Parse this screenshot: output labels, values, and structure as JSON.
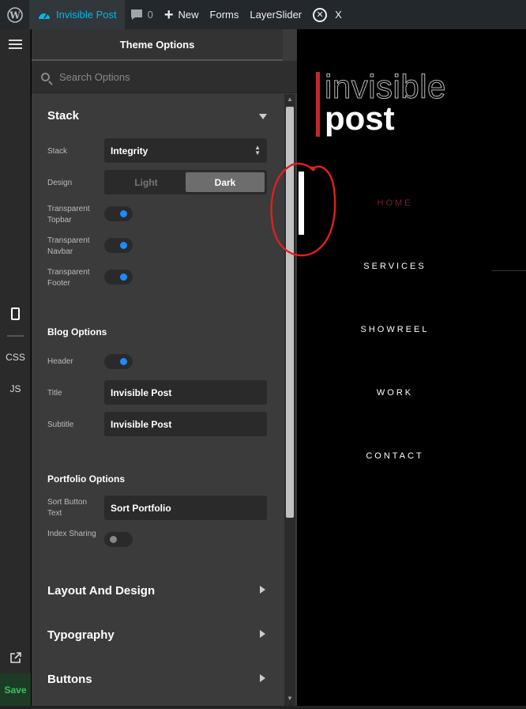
{
  "adminbar": {
    "site_name": "Invisible Post",
    "comments_count": "0",
    "new_label": "New",
    "forms_label": "Forms",
    "layerslider_label": "LayerSlider",
    "x_label": "X"
  },
  "rail": {
    "css_label": "CSS",
    "js_label": "JS",
    "save_label": "Save"
  },
  "panel": {
    "title": "Theme Options",
    "search_placeholder": "Search Options",
    "stack_section": {
      "title": "Stack",
      "stack_label": "Stack",
      "stack_value": "Integrity",
      "design_label": "Design",
      "design_options": [
        "Light",
        "Dark"
      ],
      "design_selected": "Dark",
      "transparent_topbar_label": "Transparent Topbar",
      "transparent_topbar_on": true,
      "transparent_navbar_label": "Transparent Navbar",
      "transparent_navbar_on": true,
      "transparent_footer_label": "Transparent Footer",
      "transparent_footer_on": true
    },
    "blog_options": {
      "title": "Blog Options",
      "header_label": "Header",
      "header_on": true,
      "title_label": "Title",
      "title_value": "Invisible Post",
      "subtitle_label": "Subtitle",
      "subtitle_value": "Invisible Post"
    },
    "portfolio_options": {
      "title": "Portfolio Options",
      "sort_button_label": "Sort Button Text",
      "sort_button_value": "Sort Portfolio",
      "index_sharing_label": "Index Sharing",
      "index_sharing_on": false
    },
    "collapsed_sections": {
      "layout": "Layout And Design",
      "typography": "Typography",
      "buttons": "Buttons"
    }
  },
  "preview": {
    "logo_line1": "invisible",
    "logo_line2": "post",
    "nav": [
      "HOME",
      "SERVICES",
      "SHOWREEL",
      "WORK",
      "CONTACT"
    ],
    "active_nav": "HOME",
    "accent_color": "#c62828",
    "annotation_color": "#e02020"
  },
  "colors": {
    "toggle_on": "#1a8cff",
    "save_green": "#39c45a",
    "site_link": "#00b9eb"
  }
}
